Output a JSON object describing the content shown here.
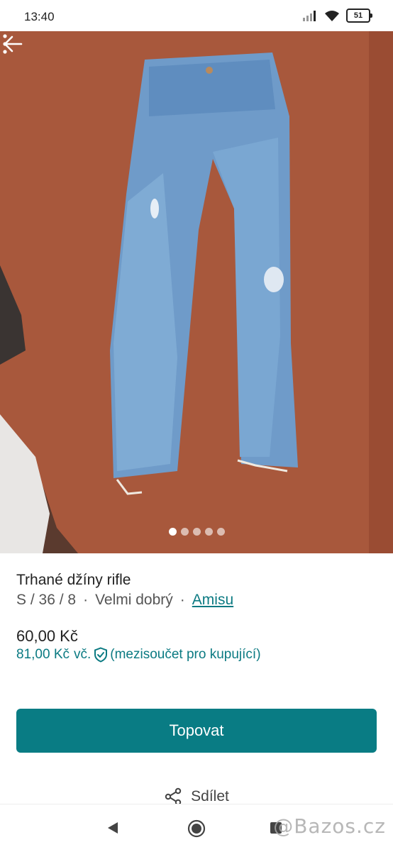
{
  "status_bar": {
    "time": "13:40",
    "battery": "51",
    "icons": [
      "signal-icon",
      "wifi-icon",
      "battery-icon"
    ]
  },
  "gallery": {
    "image_count": 5,
    "active_index": 0,
    "icons": [
      "back-arrow-icon",
      "more-vert-icon"
    ]
  },
  "item": {
    "title": "Trhané džíny rifle",
    "size": "S / 36 / 8",
    "separator": "·",
    "condition": "Velmi dobrý",
    "brand": "Amisu"
  },
  "pricing": {
    "price": "60,00 Kč",
    "total_amount": "81,00 Kč",
    "total_prefix": "vč.",
    "total_note": "(mezisoučet pro kupující)"
  },
  "actions": {
    "promote_label": "Topovat",
    "share_label": "Sdílet"
  },
  "watermark": "@Bazos.cz",
  "colors": {
    "accent": "#097c84",
    "link": "#0b7a82"
  }
}
